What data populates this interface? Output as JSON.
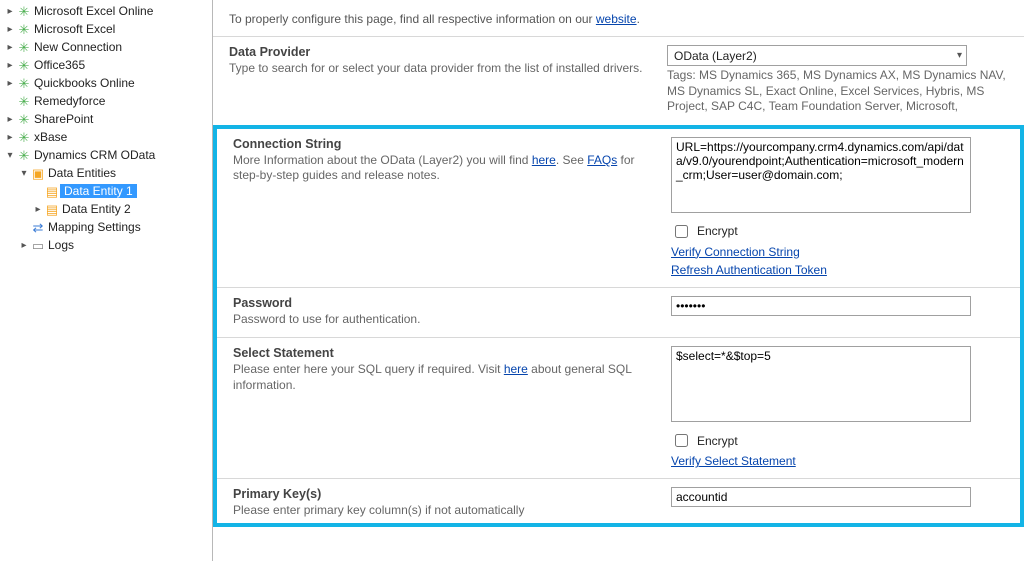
{
  "tree": [
    {
      "label": "Microsoft Excel Online",
      "icon": "puzzle",
      "chev": "right",
      "depth": 0
    },
    {
      "label": "Microsoft Excel",
      "icon": "puzzle",
      "chev": "right",
      "depth": 0
    },
    {
      "label": "New Connection",
      "icon": "puzzle",
      "chev": "right",
      "depth": 0
    },
    {
      "label": "Office365",
      "icon": "puzzle",
      "chev": "right",
      "depth": 0
    },
    {
      "label": "Quickbooks Online",
      "icon": "puzzle",
      "chev": "right",
      "depth": 0
    },
    {
      "label": "Remedyforce",
      "icon": "puzzle",
      "chev": "",
      "depth": 0
    },
    {
      "label": "SharePoint",
      "icon": "puzzle",
      "chev": "right",
      "depth": 0
    },
    {
      "label": "xBase",
      "icon": "puzzle",
      "chev": "right",
      "depth": 0
    },
    {
      "label": "Dynamics CRM OData",
      "icon": "puzzle",
      "chev": "down",
      "depth": 0
    },
    {
      "label": "Data Entities",
      "icon": "cube",
      "chev": "down",
      "depth": 1
    },
    {
      "label": "Data Entity 1",
      "icon": "page",
      "chev": "",
      "depth": 2,
      "selected": true
    },
    {
      "label": "Data Entity 2",
      "icon": "page",
      "chev": "right",
      "depth": 2
    },
    {
      "label": "Mapping Settings",
      "icon": "map",
      "chev": "",
      "depth": 1
    },
    {
      "label": "Logs",
      "icon": "logs",
      "chev": "right",
      "depth": 1
    }
  ],
  "intro": {
    "text_pre": "To properly configure this page, find all respective information on our ",
    "link": "website",
    "text_post": "."
  },
  "sections": {
    "provider": {
      "title": "Data Provider",
      "desc": "Type to search for or select your data provider from the list of installed drivers.",
      "value": "OData (Layer2)",
      "tags": "Tags: MS Dynamics 365, MS Dynamics AX, MS Dynamics NAV, MS Dynamics SL, Exact Online, Excel Services, Hybris, MS Project, SAP C4C, Team Foundation Server, Microsoft,"
    },
    "conn": {
      "title": "Connection String",
      "desc_pre": "More Information about the OData (Layer2) you will find ",
      "link1": "here",
      "desc_mid": ". See ",
      "link2": "FAQs",
      "desc_post": " for step-by-step guides and release notes.",
      "value": "URL=https://yourcompany.crm4.dynamics.com/api/data/v9.0/yourendpoint;Authentication=microsoft_modern_crm;User=user@domain.com;",
      "encrypt_label": "Encrypt",
      "verify": "Verify Connection String",
      "refresh": "Refresh Authentication Token"
    },
    "pwd": {
      "title": "Password",
      "desc": "Password to use for authentication.",
      "value": "•••••••"
    },
    "select": {
      "title": "Select Statement",
      "desc_pre": "Please enter here your SQL query if required. Visit ",
      "link": "here",
      "desc_post": " about general SQL information.",
      "value": "$select=*&$top=5",
      "encrypt_label": "Encrypt",
      "verify": "Verify Select Statement"
    },
    "pk": {
      "title": "Primary Key(s)",
      "desc": "Please enter primary key column(s) if not automatically",
      "value": "accountid"
    }
  }
}
